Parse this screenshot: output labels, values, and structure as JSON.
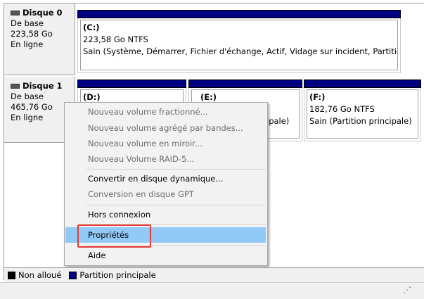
{
  "disks": [
    {
      "title": "Disque 0",
      "type": "De base",
      "size": "223,58 Go",
      "status": "En ligne",
      "partitions": [
        {
          "letter": "(C:)",
          "size": "223,58 Go NTFS",
          "status": "Sain (Système, Démarrer, Fichier d'échange, Actif, Vidage sur incident, Partition princi"
        }
      ]
    },
    {
      "title": "Disque 1",
      "type": "De base",
      "size": "465,76 Go",
      "status": "En ligne",
      "partitions": [
        {
          "letter": "(D:)",
          "size": "",
          "status": ""
        },
        {
          "letter": "(E:)",
          "size": "",
          "status": "ipale)"
        },
        {
          "letter": "(F:)",
          "size": "182,76 Go NTFS",
          "status": "Sain (Partition principale)"
        }
      ]
    }
  ],
  "context_menu": {
    "items": [
      {
        "label": "Nouveau volume fractionné...",
        "enabled": false
      },
      {
        "label": "Nouveau volume agrégé par bandes...",
        "enabled": false
      },
      {
        "label": "Nouveau volume en miroir...",
        "enabled": false
      },
      {
        "label": "Nouveau Volume RAID-5...",
        "enabled": false
      },
      {
        "label": "Convertir en disque dynamique...",
        "enabled": true
      },
      {
        "label": "Conversion en disque GPT",
        "enabled": false
      },
      {
        "label": "Hors connexion",
        "enabled": true
      },
      {
        "label": "Propriétés",
        "enabled": true,
        "highlighted": true
      },
      {
        "label": "Aide",
        "enabled": true
      }
    ]
  },
  "legend": {
    "unallocated": {
      "label": "Non alloué",
      "color": "#000000"
    },
    "primary": {
      "label": "Partition principale",
      "color": "#000080"
    }
  },
  "colors": {
    "partition_bar": "#000080",
    "menu_highlight": "#91c9f7",
    "annotation_box": "#e53935"
  }
}
